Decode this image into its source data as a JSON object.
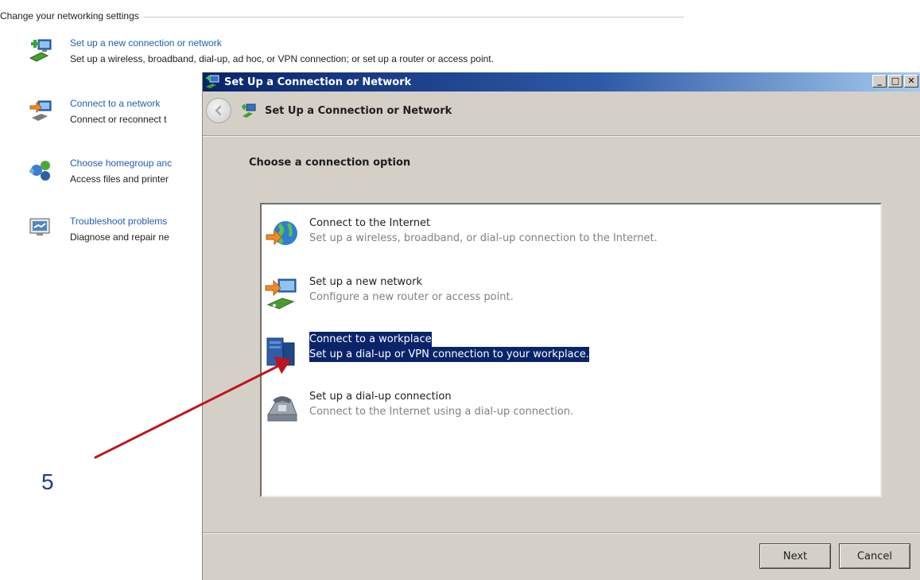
{
  "control_panel": {
    "section_header": "Change your networking settings",
    "tasks": [
      {
        "link": "Set up a new connection or network",
        "desc": "Set up a wireless, broadband, dial-up, ad hoc, or VPN connection; or set up a router or access point.",
        "icon": "network-setup-icon"
      },
      {
        "link": "Connect to a network",
        "desc": "Connect or reconnect t",
        "icon": "connect-network-icon"
      },
      {
        "link": "Choose homegroup anc",
        "desc": "Access files and printer",
        "icon": "homegroup-icon"
      },
      {
        "link": "Troubleshoot problems",
        "desc": "Diagnose and repair ne",
        "icon": "troubleshoot-icon"
      }
    ]
  },
  "dialog": {
    "title": "Set Up a Connection or Network",
    "nav_title": "Set Up a Connection or Network",
    "heading": "Choose a connection option",
    "window_buttons": {
      "minimize": "_",
      "maximize": "□",
      "close": "✕"
    },
    "options": [
      {
        "title": "Connect to the Internet",
        "desc": "Set up a wireless, broadband, or dial-up connection to the Internet.",
        "icon": "globe-icon",
        "selected": false
      },
      {
        "title": "Set up a new network",
        "desc": "Configure a new router or access point.",
        "icon": "router-icon",
        "selected": false
      },
      {
        "title": "Connect to a workplace",
        "desc": "Set up a dial-up or VPN connection to your workplace.",
        "icon": "workplace-icon",
        "selected": true
      },
      {
        "title": "Set up a dial-up connection",
        "desc": "Connect to the Internet using a dial-up connection.",
        "icon": "phone-icon",
        "selected": false
      }
    ],
    "next_label": "Next",
    "cancel_label": "Cancel"
  },
  "annotation": {
    "step_number": "5",
    "arrow_color": "#c0141c"
  },
  "colors": {
    "link": "#1f5fb0",
    "selection": "#0a246a",
    "dialog_bg": "#d4d0c8"
  }
}
